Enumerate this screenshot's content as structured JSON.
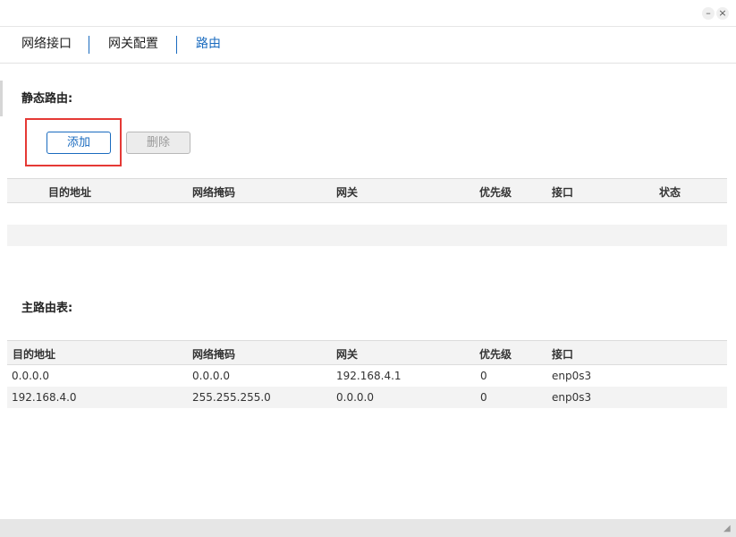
{
  "window": {
    "minimize_icon": "–",
    "close_icon": "×"
  },
  "tabs": [
    {
      "label": "网络接口"
    },
    {
      "label": "网关配置"
    },
    {
      "label": "路由"
    }
  ],
  "static_route": {
    "title": "静态路由:",
    "add_label": "添加",
    "delete_label": "删除",
    "columns": [
      "目的地址",
      "网络掩码",
      "网关",
      "优先级",
      "接口",
      "状态"
    ]
  },
  "main_route": {
    "title": "主路由表:",
    "columns": [
      "目的地址",
      "网络掩码",
      "网关",
      "优先级",
      "接口"
    ],
    "rows": [
      [
        "0.0.0.0",
        "0.0.0.0",
        "192.168.4.1",
        "0",
        "enp0s3"
      ],
      [
        "192.168.4.0",
        "255.255.255.0",
        "0.0.0.0",
        "0",
        "enp0s3"
      ]
    ]
  },
  "colors": {
    "accent": "#1a6bbf",
    "highlight": "#e53935"
  },
  "resize_icon": "◢"
}
